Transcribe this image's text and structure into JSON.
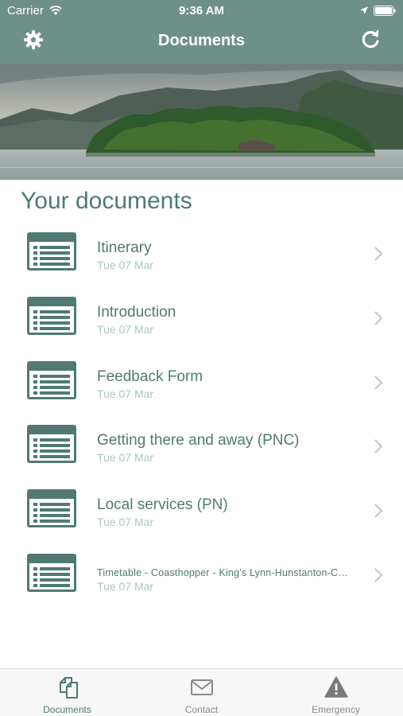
{
  "status_bar": {
    "carrier": "Carrier",
    "time": "9:36 AM"
  },
  "navbar": {
    "title": "Documents"
  },
  "section": {
    "heading": "Your documents"
  },
  "documents": [
    {
      "name": "Itinerary",
      "date": "Tue 07 Mar"
    },
    {
      "name": "Introduction",
      "date": "Tue 07 Mar"
    },
    {
      "name": "Feedback Form",
      "date": "Tue 07 Mar"
    },
    {
      "name": "Getting there and away (PNC)",
      "date": "Tue 07 Mar"
    },
    {
      "name": "Local services (PN)",
      "date": "Tue 07 Mar"
    },
    {
      "name": "Timetable - Coasthopper - King's Lynn-Hunstanton-C…",
      "date": "Tue 07 Mar"
    }
  ],
  "tabs": [
    {
      "label": "Documents",
      "icon": "documents-icon",
      "active": true
    },
    {
      "label": "Contact",
      "icon": "envelope-icon",
      "active": false
    },
    {
      "label": "Emergency",
      "icon": "warning-icon",
      "active": false
    }
  ],
  "colors": {
    "accent": "#6e9088",
    "text": "#4f7a73",
    "subtext": "#a9c7c1"
  }
}
